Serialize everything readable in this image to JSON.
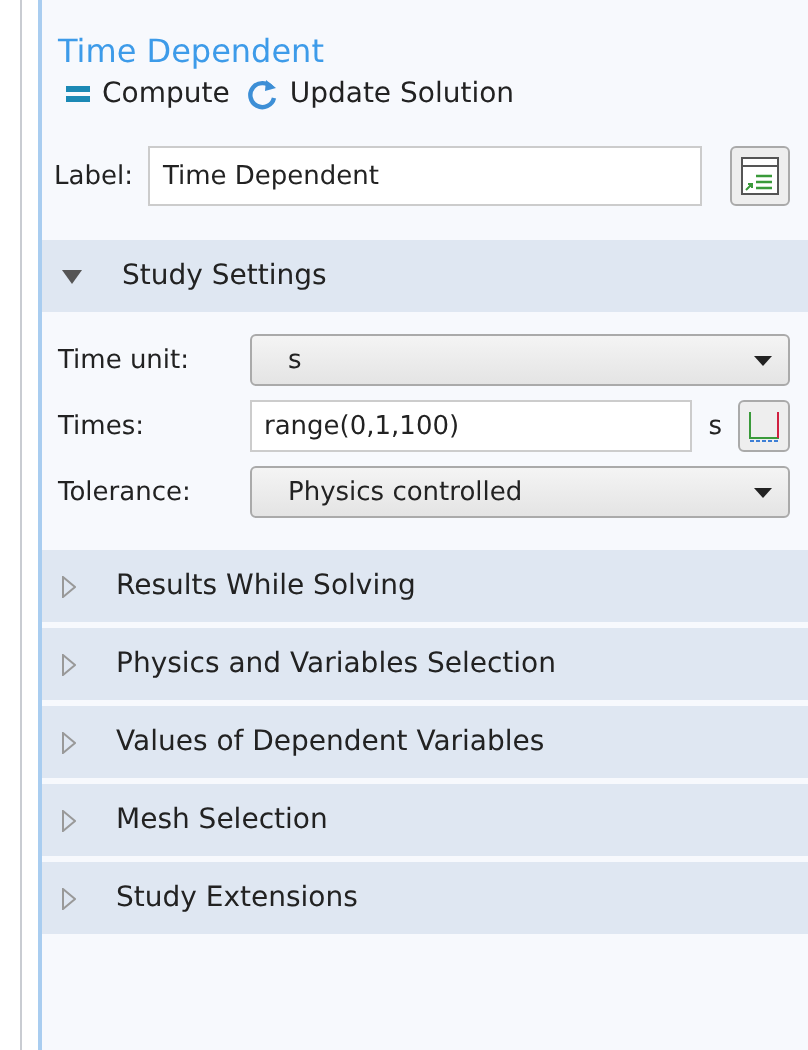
{
  "title": "Time Dependent",
  "toolbar": [
    {
      "kind": "compute",
      "label": "Compute"
    },
    {
      "kind": "update",
      "label": "Update Solution"
    }
  ],
  "label_field": {
    "label": "Label:",
    "value": "Time Dependent"
  },
  "sections": [
    {
      "title": "Study Settings",
      "expanded": true,
      "fields": [
        {
          "kind": "select",
          "label": "Time unit:",
          "value": "s"
        },
        {
          "kind": "input",
          "label": "Times:",
          "value": "range(0,1,100)",
          "unit": "s"
        },
        {
          "kind": "select",
          "label": "Tolerance:",
          "value": "Physics controlled"
        }
      ]
    },
    {
      "title": "Results While Solving",
      "expanded": false
    },
    {
      "title": "Physics and Variables Selection",
      "expanded": false
    },
    {
      "title": "Values of Dependent Variables",
      "expanded": false
    },
    {
      "title": "Mesh Selection",
      "expanded": false
    },
    {
      "title": "Study Extensions",
      "expanded": false
    }
  ]
}
